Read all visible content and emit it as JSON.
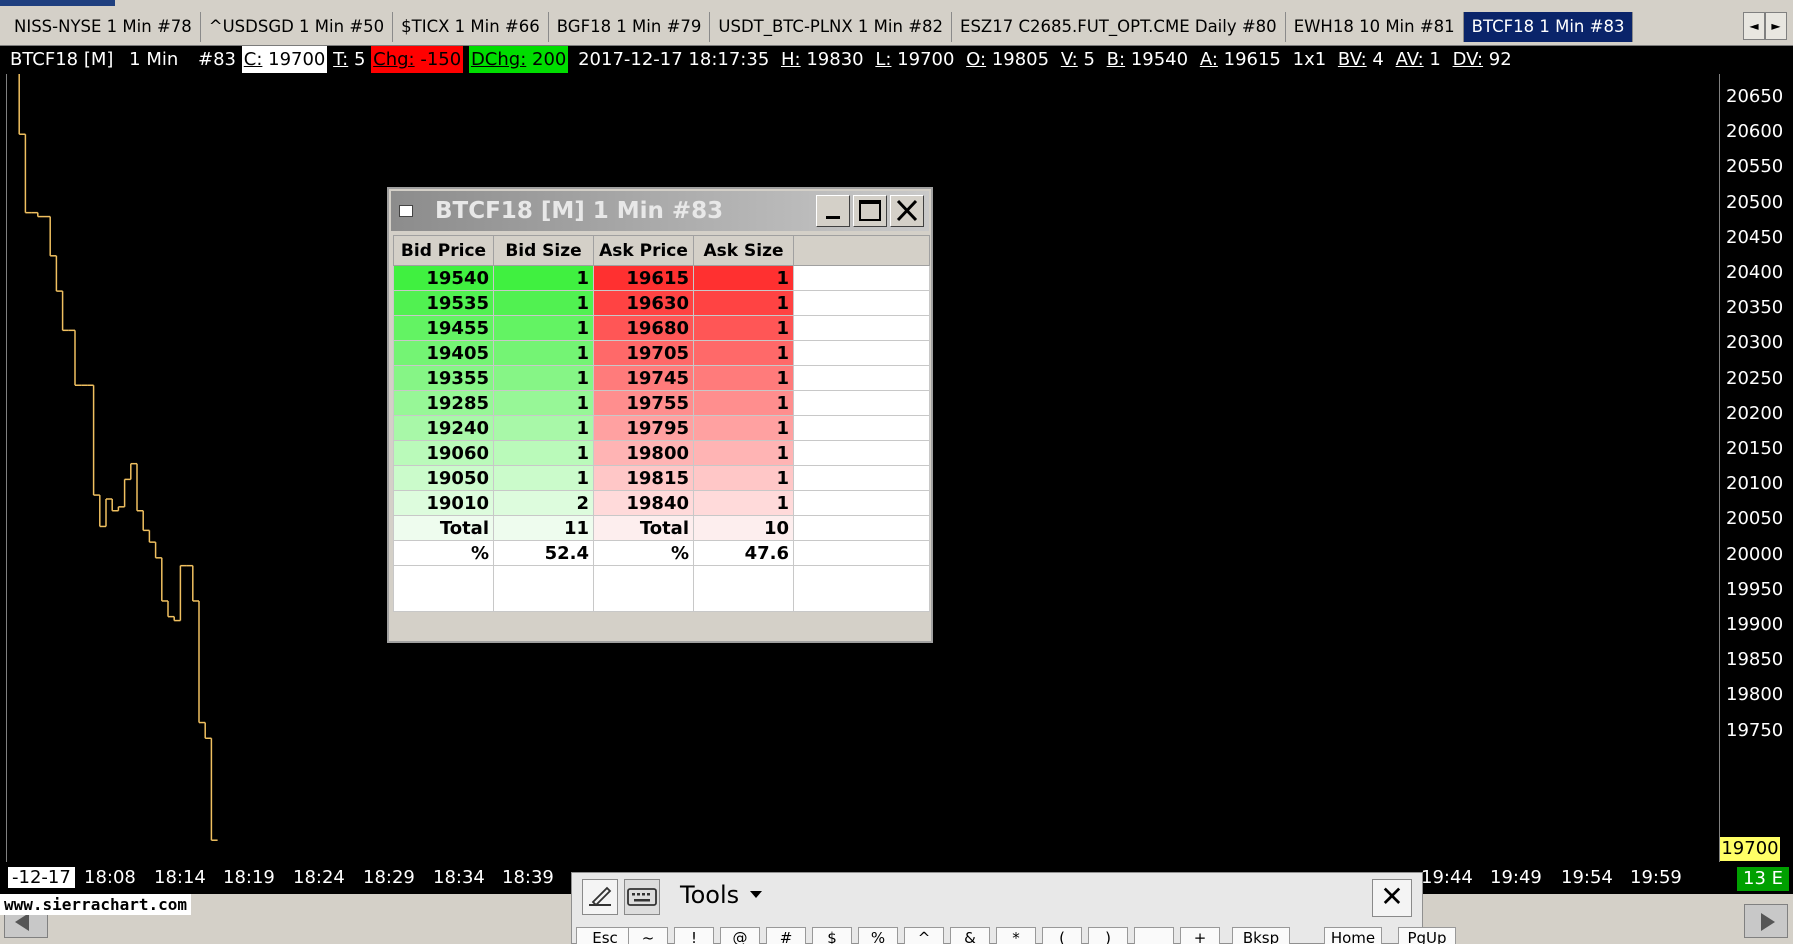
{
  "tabs": [
    {
      "label": "NISS-NYSE   1 Min   #78",
      "active": false
    },
    {
      "label": "^USDSGD   1 Min   #50",
      "active": false
    },
    {
      "label": "$TICX   1 Min   #66",
      "active": false
    },
    {
      "label": "BGF18   1 Min   #79",
      "active": false
    },
    {
      "label": "USDT_BTC-PLNX   1 Min   #82",
      "active": false
    },
    {
      "label": "ESZ17 C2685.FUT_OPT.CME   Daily   #80",
      "active": false
    },
    {
      "label": "EWH18   10 Min   #81",
      "active": false
    },
    {
      "label": "BTCF18   1 Min   #83",
      "active": true
    }
  ],
  "tab_nav": {
    "prev_icon": "◄",
    "next_icon": "►"
  },
  "info_bar": {
    "symbol": "BTCF18 [M]",
    "interval": "1 Min",
    "chart_num": "#83",
    "close": {
      "label": "C:",
      "value": "19700"
    },
    "trades": {
      "label": "T:",
      "value": "5"
    },
    "change": {
      "label": "Chg:",
      "value": "-150"
    },
    "dchange": {
      "label": "DChg:",
      "value": "200"
    },
    "datetime": "2017-12-17  18:17:35",
    "high": {
      "label": "H:",
      "value": "19830"
    },
    "low": {
      "label": "L:",
      "value": "19700"
    },
    "open": {
      "label": "O:",
      "value": "19805"
    },
    "volume": {
      "label": "V:",
      "value": "5"
    },
    "bid": {
      "label": "B:",
      "value": "19540"
    },
    "ask": {
      "label": "A:",
      "value": "19615"
    },
    "size": "1x1",
    "bid_volume": {
      "label": "BV:",
      "value": "4"
    },
    "ask_volume": {
      "label": "AV:",
      "value": "1"
    },
    "daily_volume": {
      "label": "DV:",
      "value": "92"
    }
  },
  "colors": {
    "background": "#000000",
    "price_line": "#f0c060",
    "bid_strong": "#40f040",
    "ask_strong": "#ff3030",
    "last_price_bg": "#ffff66"
  },
  "price_axis": {
    "labels": [
      "20650",
      "20600",
      "20550",
      "20500",
      "20450",
      "20400",
      "20350",
      "20300",
      "20250",
      "20200",
      "20150",
      "20100",
      "20050",
      "20000",
      "19950",
      "19900",
      "19850",
      "19800",
      "19750"
    ],
    "last_price": "19700",
    "scale_max": 20650,
    "scale_min": 19750
  },
  "time_axis": {
    "date_label": "-12-17",
    "labels": [
      "18:08",
      "18:14",
      "18:19",
      "18:24",
      "18:29",
      "18:34",
      "18:39",
      "19:44",
      "19:49",
      "19:54",
      "19:59"
    ],
    "bars_label": "13 E"
  },
  "price_series": [
    20700,
    20600,
    20500,
    20500,
    20495,
    20495,
    20445,
    20400,
    20350,
    20350,
    20280,
    20280,
    20280,
    20140,
    20100,
    20135,
    20120,
    20125,
    20160,
    20180,
    20120,
    20095,
    20080,
    20060,
    20005,
    19985,
    19980,
    20050,
    20050,
    20005,
    19850,
    19830,
    19700
  ],
  "dom": {
    "title": "BTCF18 [M]   1 Min   #83",
    "headers": [
      "Bid Price",
      "Bid Size",
      "Ask Price",
      "Ask Size"
    ],
    "rows": [
      {
        "bid_price": "19540",
        "bid_size": "1",
        "ask_price": "19615",
        "ask_size": "1"
      },
      {
        "bid_price": "19535",
        "bid_size": "1",
        "ask_price": "19630",
        "ask_size": "1"
      },
      {
        "bid_price": "19455",
        "bid_size": "1",
        "ask_price": "19680",
        "ask_size": "1"
      },
      {
        "bid_price": "19405",
        "bid_size": "1",
        "ask_price": "19705",
        "ask_size": "1"
      },
      {
        "bid_price": "19355",
        "bid_size": "1",
        "ask_price": "19745",
        "ask_size": "1"
      },
      {
        "bid_price": "19285",
        "bid_size": "1",
        "ask_price": "19755",
        "ask_size": "1"
      },
      {
        "bid_price": "19240",
        "bid_size": "1",
        "ask_price": "19795",
        "ask_size": "1"
      },
      {
        "bid_price": "19060",
        "bid_size": "1",
        "ask_price": "19800",
        "ask_size": "1"
      },
      {
        "bid_price": "19050",
        "bid_size": "1",
        "ask_price": "19815",
        "ask_size": "1"
      },
      {
        "bid_price": "19010",
        "bid_size": "2",
        "ask_price": "19840",
        "ask_size": "1"
      }
    ],
    "total": {
      "label": "Total",
      "bid_total": "11",
      "ask_total": "10"
    },
    "percent": {
      "label": "%",
      "bid_pct": "52.4",
      "ask_pct": "47.6"
    }
  },
  "footer": {
    "website": "www.sierrachart.com"
  },
  "keyboard": {
    "tools_label": "Tools",
    "keys": [
      "Esc",
      "~",
      "!",
      "@",
      "#",
      "$",
      "%",
      "^",
      "&",
      "*",
      "(",
      ")",
      "_",
      "+",
      "Bksp",
      "Home",
      "PgUp"
    ]
  }
}
